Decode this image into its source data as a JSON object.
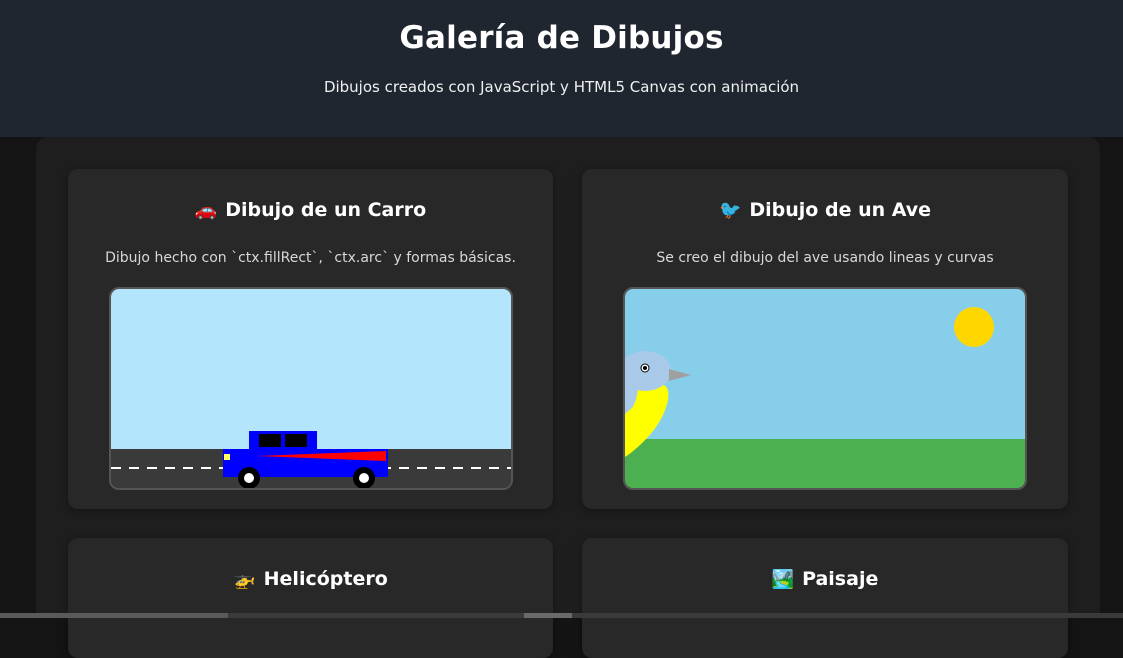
{
  "header": {
    "title": "Galería de Dibujos",
    "subtitle": "Dibujos creados con JavaScript y HTML5 Canvas con animación"
  },
  "cards": [
    {
      "emoji": "🚗",
      "title": "Dibujo de un Carro",
      "description": "Dibujo hecho con `ctx.fillRect`, `ctx.arc` y formas básicas."
    },
    {
      "emoji": "🐦",
      "title": "Dibujo de un Ave",
      "description": "Se creo el dibujo del ave usando lineas y curvas"
    },
    {
      "emoji": "🚁",
      "title": "Helicóptero"
    },
    {
      "emoji": "🏞️",
      "title": "Paisaje"
    }
  ],
  "colors": {
    "header_bg": "#1f2630",
    "card_bg": "#282828",
    "car_sky": "#b3e5fc",
    "car_body": "#0000ff",
    "car_stripe": "#ff0000",
    "bird_sky": "#87ceeb",
    "grass": "#4caf50",
    "sun": "#ffd700",
    "bird_belly": "#ffff00"
  }
}
